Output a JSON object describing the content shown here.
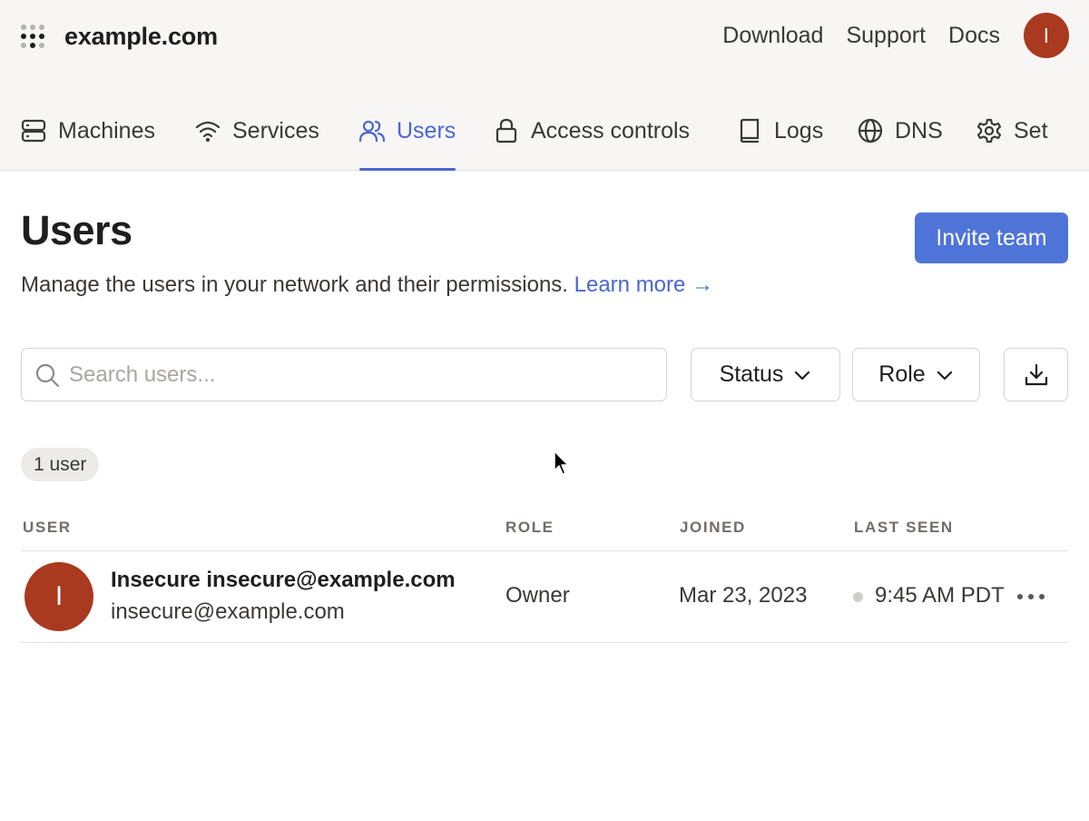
{
  "header": {
    "brand_name": "example.com",
    "links": [
      "Download",
      "Support",
      "Docs"
    ],
    "avatar_initial": "I"
  },
  "tabs": [
    {
      "label": "Machines",
      "icon": "server-icon",
      "active": false
    },
    {
      "label": "Services",
      "icon": "wifi-icon",
      "active": false
    },
    {
      "label": "Users",
      "icon": "users-icon",
      "active": true
    },
    {
      "label": "Access controls",
      "icon": "lock-icon",
      "active": false
    },
    {
      "label": "Logs",
      "icon": "book-icon",
      "active": false
    },
    {
      "label": "DNS",
      "icon": "globe-icon",
      "active": false
    },
    {
      "label": "Set",
      "icon": "gear-icon",
      "active": false
    }
  ],
  "page": {
    "title": "Users",
    "subtitle": "Manage the users in your network and their permissions.",
    "learn_more": "Learn more →",
    "invite_button": "Invite team"
  },
  "filters": {
    "search_placeholder": "Search users...",
    "status_label": "Status",
    "role_label": "Role",
    "export_icon": "download-icon"
  },
  "count_badge": "1 user",
  "table": {
    "columns": [
      "USER",
      "ROLE",
      "JOINED",
      "LAST SEEN"
    ],
    "rows": [
      {
        "avatar_initial": "I",
        "name": "Insecure insecure@example.com",
        "email": "insecure@example.com",
        "role": "Owner",
        "joined": "Mar 23, 2023",
        "last_seen": "9:45 AM PDT"
      }
    ]
  },
  "colors": {
    "accent": "#4a67cf",
    "button": "#4f74d8",
    "avatar": "#a9391f",
    "header_bg": "#f7f6f5"
  }
}
